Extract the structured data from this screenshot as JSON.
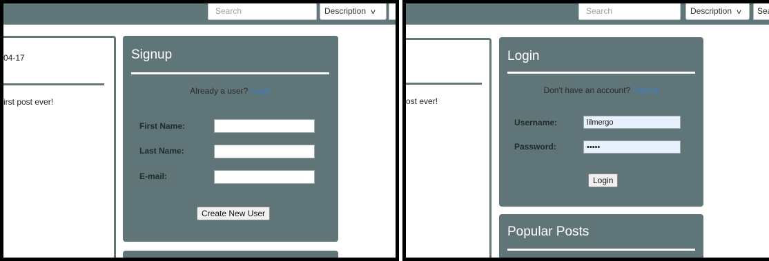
{
  "left_shot": {
    "search_placeholder": "Search",
    "filter_select": "Description",
    "post": {
      "date_fragment": "04-17",
      "body_fragment": "irst post ever!"
    },
    "signup": {
      "title": "Signup",
      "switch_prompt": "Already a user?",
      "switch_link": "Login",
      "labels": [
        "First Name:",
        "Last Name:",
        "E-mail:"
      ],
      "values": [
        "",
        "",
        ""
      ],
      "submit_label": "Create New User"
    }
  },
  "right_shot": {
    "search_placeholder": "Search",
    "filter_select": "Description",
    "search_button_fragment": "Sea",
    "post": {
      "body_fragment": "ost ever!"
    },
    "login": {
      "title": "Login",
      "switch_prompt": "Don't have an account?",
      "switch_link": "Signup",
      "username_label": "Username:",
      "username_value": "lilmergo",
      "password_label": "Password:",
      "password_value": "•••••",
      "submit_label": "Login"
    },
    "popular": {
      "title": "Popular Posts"
    }
  },
  "colors": {
    "panel": "#607578",
    "link": "#3d7fc4",
    "frame": "#000000"
  }
}
